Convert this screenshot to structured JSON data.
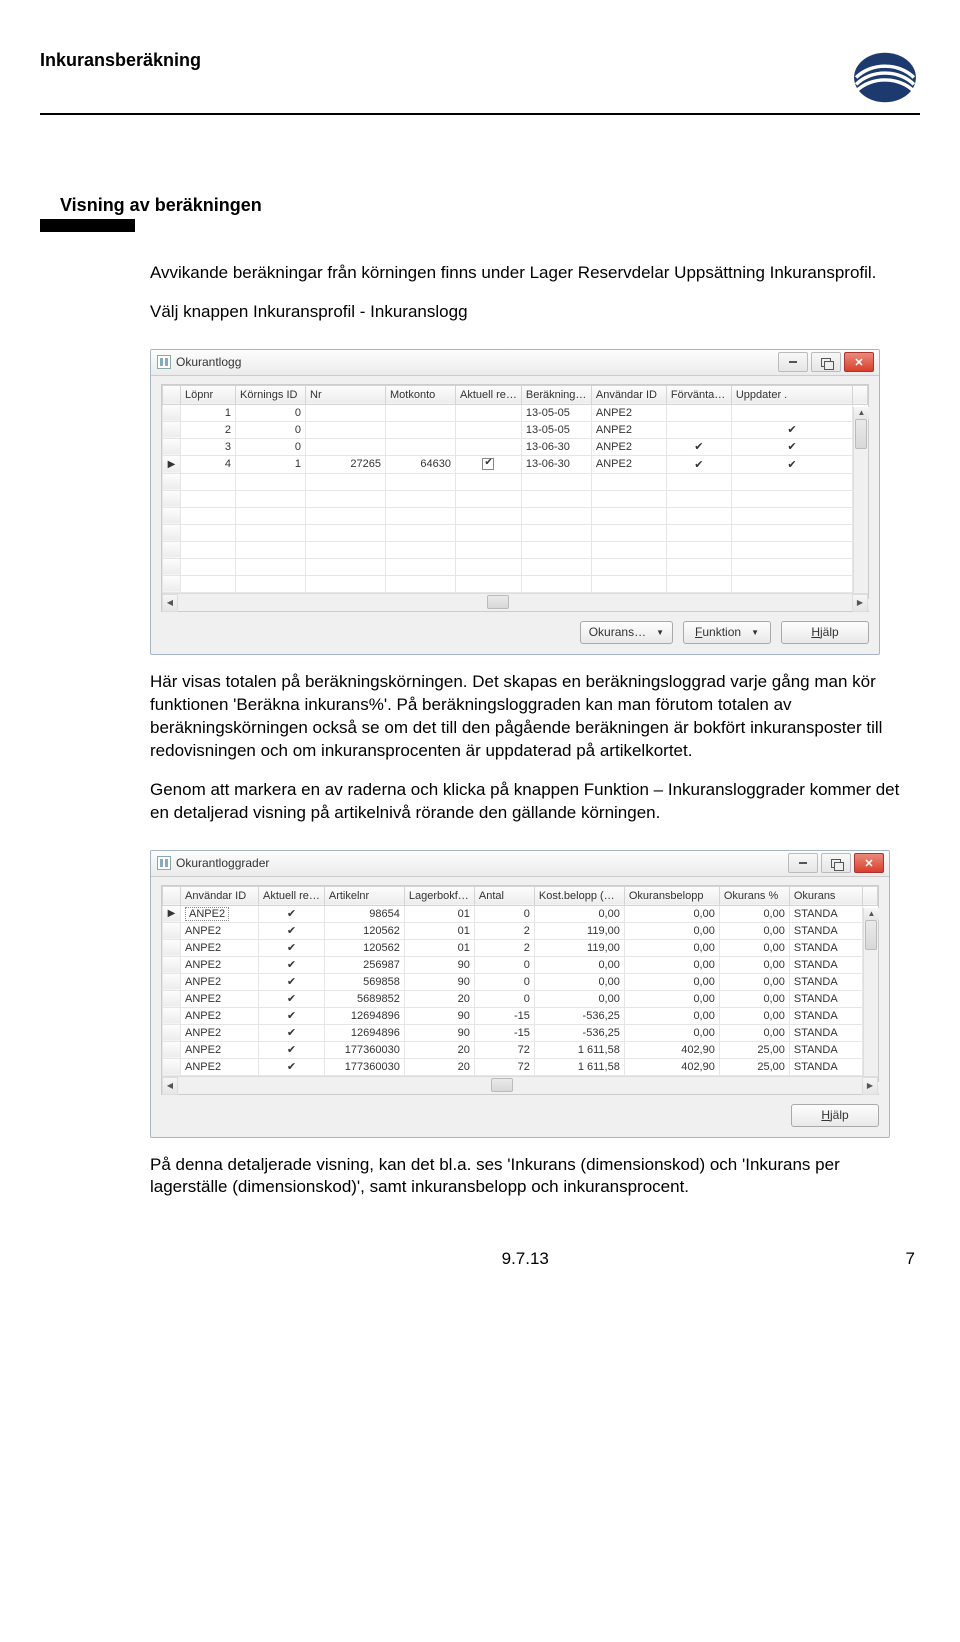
{
  "header": {
    "title": "Inkuransberäkning"
  },
  "section": {
    "heading": "Visning av beräkningen"
  },
  "para1": "Avvikande beräkningar från körningen finns under Lager Reservdelar Uppsättning Inkuransprofil.",
  "para2": "Välj knappen Inkuransprofil - Inkuranslogg",
  "window1": {
    "title": "Okurantlogg",
    "columns": [
      "",
      "Löpnr",
      "Körnings ID",
      "Nr",
      "Motkonto",
      "Aktuell re…",
      "Beräkning…",
      "Användar ID",
      "Förvänta…",
      "Uppdater ."
    ],
    "rows": [
      [
        "",
        "1",
        "0",
        "",
        "",
        "",
        "13-05-05",
        "ANPE2",
        "",
        ""
      ],
      [
        "",
        "2",
        "0",
        "",
        "",
        "",
        "13-05-05",
        "ANPE2",
        "",
        "✔"
      ],
      [
        "",
        "3",
        "0",
        "",
        "",
        "",
        "13-06-30",
        "ANPE2",
        "✔",
        "✔"
      ],
      [
        "▶",
        "4",
        "1",
        "27265",
        "64630",
        "boxcheck",
        "13-06-30",
        "ANPE2",
        "✔",
        "✔"
      ]
    ],
    "buttons": {
      "okurans": "Okurans…",
      "funktion": "Funktion",
      "funktion_access_char": "F",
      "hjalp": "Hjälp",
      "hjalp_access_char": "H"
    }
  },
  "para3": "Här visas totalen på beräkningskörningen. Det skapas en beräkningsloggrad varje gång man kör funktionen 'Beräkna inkurans%'. På beräkningsloggraden kan man förutom totalen av beräkningskörningen också se om det till den pågående beräkningen är bokfört inkuransposter till redovisningen och om inkuransprocenten är uppdaterad på artikelkortet.",
  "para4": "Genom att markera en av raderna och klicka på knappen Funktion – Inkuransloggrader kommer det en detaljerad visning på artikelnivå rörande den gällande körningen.",
  "window2": {
    "title": "Okurantloggrader",
    "columns": [
      "",
      "Användar ID",
      "Aktuell re…",
      "Artikelnr",
      "Lagerbokf…",
      "Antal",
      "Kost.belopp (…",
      "Okuransbelopp",
      "Okurans %",
      "Okurans"
    ],
    "rows": [
      [
        "▶",
        "ANPE2*",
        "✔",
        "98654",
        "01",
        "0",
        "0,00",
        "0,00",
        "0,00",
        "STANDA"
      ],
      [
        "",
        "ANPE2",
        "✔",
        "120562",
        "01",
        "2",
        "119,00",
        "0,00",
        "0,00",
        "STANDA"
      ],
      [
        "",
        "ANPE2",
        "✔",
        "120562",
        "01",
        "2",
        "119,00",
        "0,00",
        "0,00",
        "STANDA"
      ],
      [
        "",
        "ANPE2",
        "✔",
        "256987",
        "90",
        "0",
        "0,00",
        "0,00",
        "0,00",
        "STANDA"
      ],
      [
        "",
        "ANPE2",
        "✔",
        "569858",
        "90",
        "0",
        "0,00",
        "0,00",
        "0,00",
        "STANDA"
      ],
      [
        "",
        "ANPE2",
        "✔",
        "5689852",
        "20",
        "0",
        "0,00",
        "0,00",
        "0,00",
        "STANDA"
      ],
      [
        "",
        "ANPE2",
        "✔",
        "12694896",
        "90",
        "-15",
        "-536,25",
        "0,00",
        "0,00",
        "STANDA"
      ],
      [
        "",
        "ANPE2",
        "✔",
        "12694896",
        "90",
        "-15",
        "-536,25",
        "0,00",
        "0,00",
        "STANDA"
      ],
      [
        "",
        "ANPE2",
        "✔",
        "177360030",
        "20",
        "72",
        "1 611,58",
        "402,90",
        "25,00",
        "STANDA"
      ],
      [
        "",
        "ANPE2",
        "✔",
        "177360030",
        "20",
        "72",
        "1 611,58",
        "402,90",
        "25,00",
        "STANDA"
      ]
    ],
    "buttons": {
      "hjalp": "Hjälp",
      "hjalp_access_char": "H"
    }
  },
  "para5": "På denna detaljerade visning, kan det bl.a. ses 'Inkurans (dimensionskod) och 'Inkurans per lagerställe (dimensionskod)', samt inkuransbelopp och inkuransprocent.",
  "footer": {
    "left": "9.7.13",
    "right": "7"
  },
  "chart_data": [
    {
      "type": "table",
      "title": "Okurantlogg",
      "columns": [
        "Löpnr",
        "Körnings ID",
        "Nr",
        "Motkonto",
        "Aktuell re…",
        "Beräkning…",
        "Användar ID",
        "Förvänta…",
        "Uppdater."
      ],
      "rows": [
        {
          "Löpnr": 1,
          "Körnings ID": 0,
          "Nr": null,
          "Motkonto": null,
          "Aktuell re": null,
          "Beräkning": "13-05-05",
          "Användar ID": "ANPE2",
          "Förvänta": false,
          "Uppdater": false
        },
        {
          "Löpnr": 2,
          "Körnings ID": 0,
          "Nr": null,
          "Motkonto": null,
          "Aktuell re": null,
          "Beräkning": "13-05-05",
          "Användar ID": "ANPE2",
          "Förvänta": false,
          "Uppdater": true
        },
        {
          "Löpnr": 3,
          "Körnings ID": 0,
          "Nr": null,
          "Motkonto": null,
          "Aktuell re": null,
          "Beräkning": "13-06-30",
          "Användar ID": "ANPE2",
          "Förvänta": true,
          "Uppdater": true
        },
        {
          "Löpnr": 4,
          "Körnings ID": 1,
          "Nr": 27265,
          "Motkonto": 64630,
          "Aktuell re": true,
          "Beräkning": "13-06-30",
          "Användar ID": "ANPE2",
          "Förvänta": true,
          "Uppdater": true
        }
      ]
    },
    {
      "type": "table",
      "title": "Okurantloggrader",
      "columns": [
        "Användar ID",
        "Aktuell re…",
        "Artikelnr",
        "Lagerbokf…",
        "Antal",
        "Kost.belopp",
        "Okuransbelopp",
        "Okurans %",
        "Okurans"
      ],
      "rows": [
        {
          "Användar ID": "ANPE2",
          "Aktuell re": true,
          "Artikelnr": 98654,
          "Lagerbokf": "01",
          "Antal": 0,
          "Kost.belopp": 0.0,
          "Okuransbelopp": 0.0,
          "Okurans %": 0.0,
          "Okurans": "STANDA"
        },
        {
          "Användar ID": "ANPE2",
          "Aktuell re": true,
          "Artikelnr": 120562,
          "Lagerbokf": "01",
          "Antal": 2,
          "Kost.belopp": 119.0,
          "Okuransbelopp": 0.0,
          "Okurans %": 0.0,
          "Okurans": "STANDA"
        },
        {
          "Användar ID": "ANPE2",
          "Aktuell re": true,
          "Artikelnr": 120562,
          "Lagerbokf": "01",
          "Antal": 2,
          "Kost.belopp": 119.0,
          "Okuransbelopp": 0.0,
          "Okurans %": 0.0,
          "Okurans": "STANDA"
        },
        {
          "Användar ID": "ANPE2",
          "Aktuell re": true,
          "Artikelnr": 256987,
          "Lagerbokf": "90",
          "Antal": 0,
          "Kost.belopp": 0.0,
          "Okuransbelopp": 0.0,
          "Okurans %": 0.0,
          "Okurans": "STANDA"
        },
        {
          "Användar ID": "ANPE2",
          "Aktuell re": true,
          "Artikelnr": 569858,
          "Lagerbokf": "90",
          "Antal": 0,
          "Kost.belopp": 0.0,
          "Okuransbelopp": 0.0,
          "Okurans %": 0.0,
          "Okurans": "STANDA"
        },
        {
          "Användar ID": "ANPE2",
          "Aktuell re": true,
          "Artikelnr": 5689852,
          "Lagerbokf": "20",
          "Antal": 0,
          "Kost.belopp": 0.0,
          "Okuransbelopp": 0.0,
          "Okurans %": 0.0,
          "Okurans": "STANDA"
        },
        {
          "Användar ID": "ANPE2",
          "Aktuell re": true,
          "Artikelnr": 12694896,
          "Lagerbokf": "90",
          "Antal": -15,
          "Kost.belopp": -536.25,
          "Okuransbelopp": 0.0,
          "Okurans %": 0.0,
          "Okurans": "STANDA"
        },
        {
          "Användar ID": "ANPE2",
          "Aktuell re": true,
          "Artikelnr": 12694896,
          "Lagerbokf": "90",
          "Antal": -15,
          "Kost.belopp": -536.25,
          "Okuransbelopp": 0.0,
          "Okurans %": 0.0,
          "Okurans": "STANDA"
        },
        {
          "Användar ID": "ANPE2",
          "Aktuell re": true,
          "Artikelnr": 177360030,
          "Lagerbokf": "20",
          "Antal": 72,
          "Kost.belopp": 1611.58,
          "Okuransbelopp": 402.9,
          "Okurans %": 25.0,
          "Okurans": "STANDA"
        },
        {
          "Användar ID": "ANPE2",
          "Aktuell re": true,
          "Artikelnr": 177360030,
          "Lagerbokf": "20",
          "Antal": 72,
          "Kost.belopp": 1611.58,
          "Okuransbelopp": 402.9,
          "Okurans %": 25.0,
          "Okurans": "STANDA"
        }
      ]
    }
  ]
}
